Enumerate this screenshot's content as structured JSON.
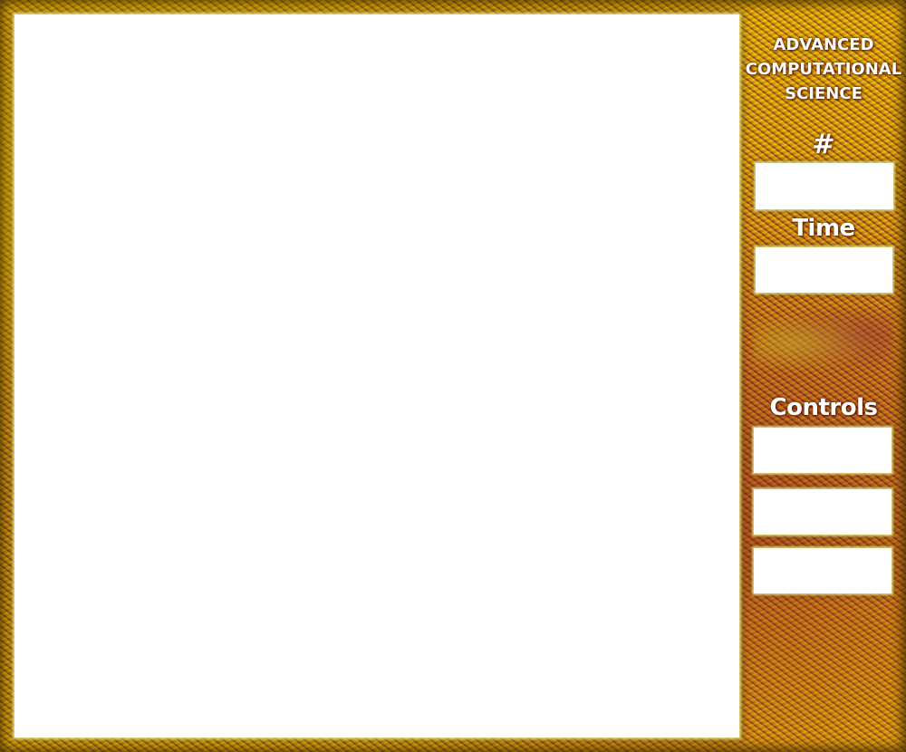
{
  "panel": {
    "title_line1": "ADVANCED",
    "title_line2": "COMPUTATIONAL",
    "title_line3": "SCIENCE",
    "count_label": "#",
    "count_value": "",
    "time_label": "Time",
    "time_value": "",
    "controls_label": "Controls",
    "controls": [
      {
        "label": ""
      },
      {
        "label": ""
      },
      {
        "label": ""
      }
    ]
  },
  "colors": {
    "frame_yellow": "#e0c000",
    "frame_maroon": "#8a2a28",
    "canvas": "#ffffff",
    "text": "#ffffff"
  }
}
